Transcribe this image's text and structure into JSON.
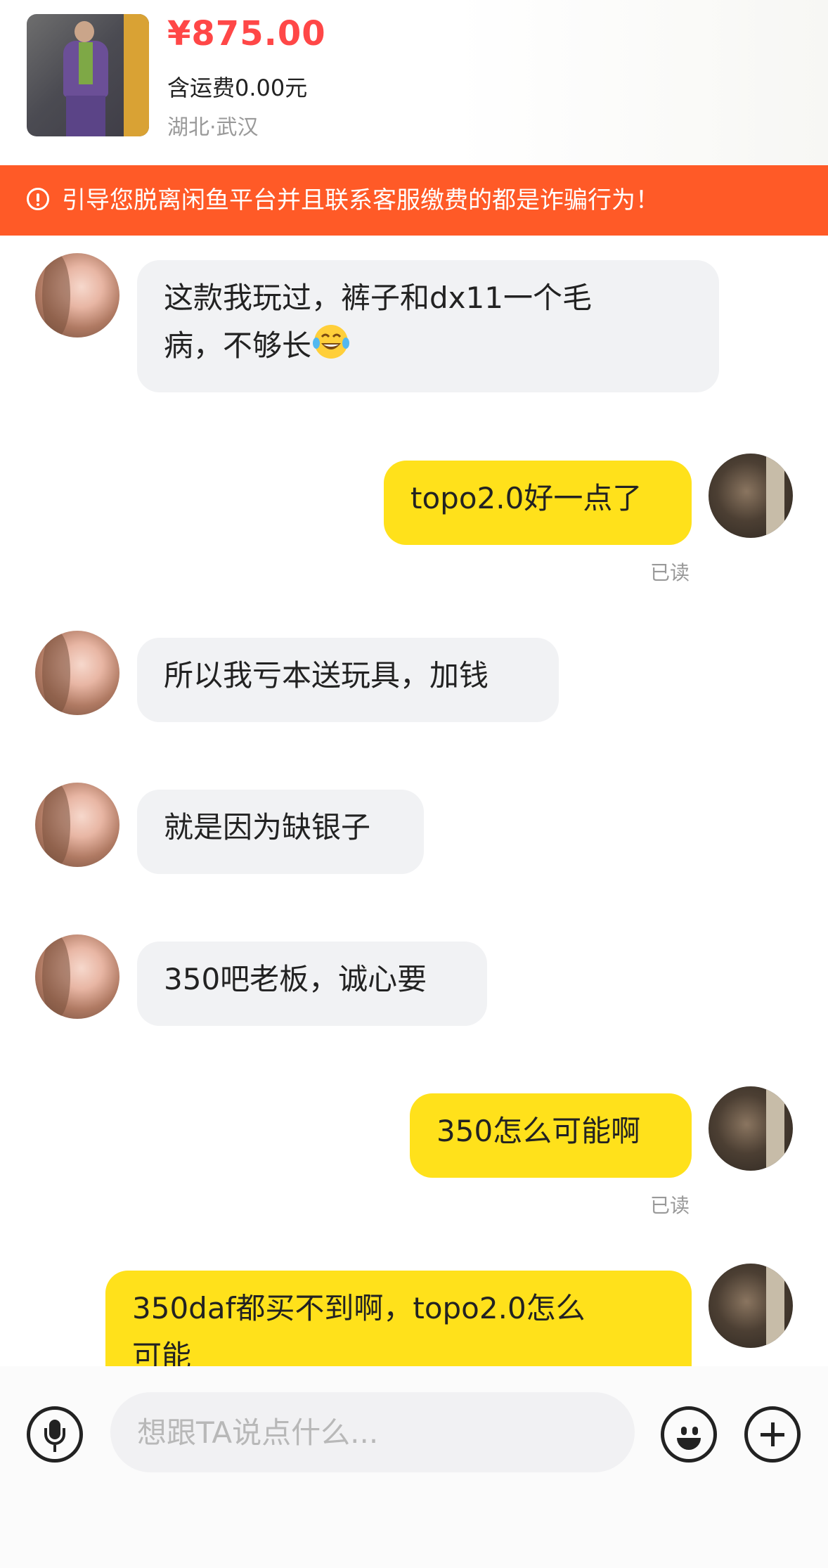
{
  "product": {
    "price": "¥875.00",
    "shipping": "含运费0.00元",
    "location": "湖北·武汉"
  },
  "warning": {
    "icon": "exclamation-circle-icon",
    "text": "引导您脱离闲鱼平台并且联系客服缴费的都是诈骗行为！"
  },
  "messages": [
    {
      "sender": "seller",
      "text_line1": "这款我玩过，裤子和dx11一个毛",
      "text_line2": "病，不够长",
      "emoji": "laughing-tears-emoji"
    },
    {
      "sender": "me",
      "text": "topo2.0好一点了",
      "status": "已读"
    },
    {
      "sender": "seller",
      "text": "所以我亏本送玩具，加钱"
    },
    {
      "sender": "seller",
      "text": "就是因为缺银子"
    },
    {
      "sender": "seller",
      "text": "350吧老板，诚心要"
    },
    {
      "sender": "me",
      "text": "350怎么可能啊",
      "status": "已读"
    },
    {
      "sender": "me",
      "text_line1": "350daf都买不到啊，topo2.0怎么",
      "text_line2": "可能"
    }
  ],
  "input": {
    "placeholder": "想跟TA说点什么..."
  },
  "colors": {
    "price": "#ff4747",
    "warning_banner": "#ff5a27",
    "outgoing_bubble": "#ffe11b",
    "incoming_bubble": "#f1f2f4"
  }
}
